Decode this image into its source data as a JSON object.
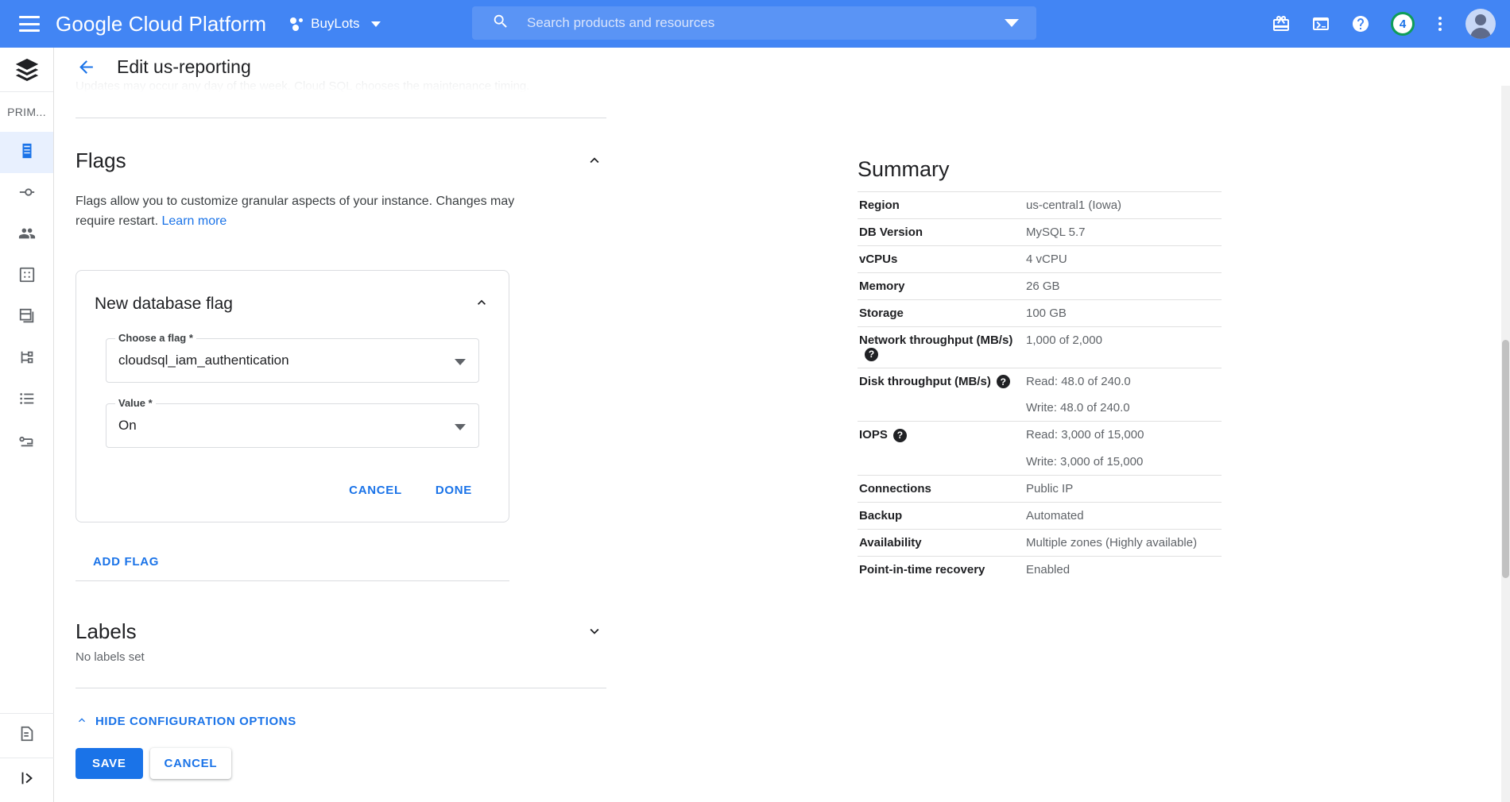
{
  "topbar": {
    "menu_icon": "hamburger-icon",
    "product_title": "Google Cloud Platform",
    "project_name": "BuyLots",
    "search_placeholder": "Search products and resources",
    "search_value": "",
    "icons": [
      "gift-icon",
      "cloud-shell-icon",
      "help-icon",
      "kebab-menu-icon",
      "avatar"
    ],
    "notification_count": "4",
    "brand_color": "#4285f4"
  },
  "rail": {
    "logo": "cloud-sql-logo-icon",
    "section_label": "PRIM...",
    "items": [
      {
        "name": "overview",
        "icon": "database-icon",
        "active": true
      },
      {
        "name": "connections",
        "icon": "connection-icon",
        "active": false
      },
      {
        "name": "users",
        "icon": "users-icon",
        "active": false
      },
      {
        "name": "databases",
        "icon": "grid-icon",
        "active": false
      },
      {
        "name": "backups",
        "icon": "backup-icon",
        "active": false
      },
      {
        "name": "replicas",
        "icon": "branch-icon",
        "active": false
      },
      {
        "name": "operations",
        "icon": "list-icon",
        "active": false
      },
      {
        "name": "migrations",
        "icon": "key-icon",
        "active": false
      }
    ],
    "bottom_items": [
      {
        "name": "release-notes",
        "icon": "note-add-icon"
      },
      {
        "name": "expand-rail",
        "icon": "expand-panel-icon"
      }
    ]
  },
  "page": {
    "back_label": "back-arrow",
    "title": "Edit us-reporting",
    "scrolled_text": "Updates may occur any day of the week. Cloud SQL chooses the maintenance timing."
  },
  "flags": {
    "title": "Flags",
    "collapse_icon": "chevron-up-icon",
    "description": "Flags allow you to customize granular aspects of your instance. Changes may require restart.",
    "learn_more": "Learn more",
    "card": {
      "title": "New database flag",
      "collapse_icon": "chevron-up-icon",
      "flag_field_label": "Choose a flag *",
      "flag_field_value": "cloudsql_iam_authentication",
      "value_field_label": "Value *",
      "value_field_value": "On",
      "cancel_label": "CANCEL",
      "done_label": "DONE"
    },
    "add_flag_label": "ADD FLAG"
  },
  "labels": {
    "title": "Labels",
    "subtitle": "No labels set",
    "expand_icon": "chevron-down-icon"
  },
  "footer": {
    "hide_options_label": "HIDE CONFIGURATION OPTIONS",
    "hide_options_icon": "chevron-up-icon",
    "save_label": "SAVE",
    "cancel_label": "CANCEL"
  },
  "summary": {
    "title": "Summary",
    "rows": [
      {
        "label": "Region",
        "values": [
          "us-central1 (Iowa)"
        ],
        "help": false
      },
      {
        "label": "DB Version",
        "values": [
          "MySQL 5.7"
        ],
        "help": false
      },
      {
        "label": "vCPUs",
        "values": [
          "4 vCPU"
        ],
        "help": false
      },
      {
        "label": "Memory",
        "values": [
          "26 GB"
        ],
        "help": false
      },
      {
        "label": "Storage",
        "values": [
          "100 GB"
        ],
        "help": false
      },
      {
        "label": "Network throughput (MB/s)",
        "values": [
          "1,000 of 2,000"
        ],
        "help": true
      },
      {
        "label": "Disk throughput (MB/s)",
        "values": [
          "Read: 48.0 of 240.0",
          "Write: 48.0 of 240.0"
        ],
        "help": true
      },
      {
        "label": "IOPS",
        "values": [
          "Read: 3,000 of 15,000",
          "Write: 3,000 of 15,000"
        ],
        "help": true
      },
      {
        "label": "Connections",
        "values": [
          "Public IP"
        ],
        "help": false
      },
      {
        "label": "Backup",
        "values": [
          "Automated"
        ],
        "help": false
      },
      {
        "label": "Availability",
        "values": [
          "Multiple zones (Highly available)"
        ],
        "help": false
      },
      {
        "label": "Point-in-time recovery",
        "values": [
          "Enabled"
        ],
        "help": false
      }
    ],
    "help_glyph": "?"
  }
}
